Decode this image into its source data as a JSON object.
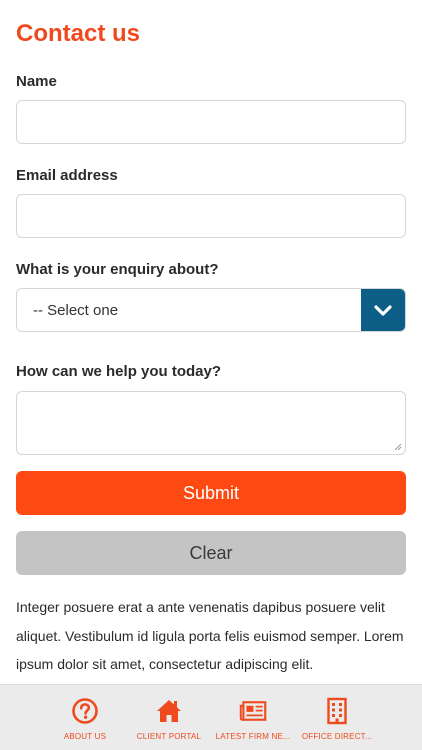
{
  "page": {
    "title": "Contact us"
  },
  "form": {
    "name_label": "Name",
    "email_label": "Email address",
    "enquiry_label": "What is your enquiry about?",
    "enquiry_selected": "-- Select one",
    "help_label": "How can we help you today?",
    "submit_label": "Submit",
    "clear_label": "Clear"
  },
  "body_text": "Integer posuere erat a ante venenatis dapibus posuere velit aliquet. Vestibulum id ligula porta felis euismod semper. Lorem ipsum dolor sit amet, consectetur adipiscing elit.",
  "tabbar": {
    "items": [
      {
        "label": "ABOUT US",
        "icon": "question-circle-icon"
      },
      {
        "label": "CLIENT PORTAL",
        "icon": "home-icon"
      },
      {
        "label": "LATEST FIRM NE...",
        "icon": "newspaper-icon"
      },
      {
        "label": "OFFICE DIRECT...",
        "icon": "building-icon"
      }
    ]
  },
  "colors": {
    "accent": "#ef4a1e",
    "submit_bg": "#fe4a12",
    "select_button_bg": "#0d5e87",
    "clear_bg": "#c4c4c4",
    "tabbar_bg": "#ebebeb"
  }
}
